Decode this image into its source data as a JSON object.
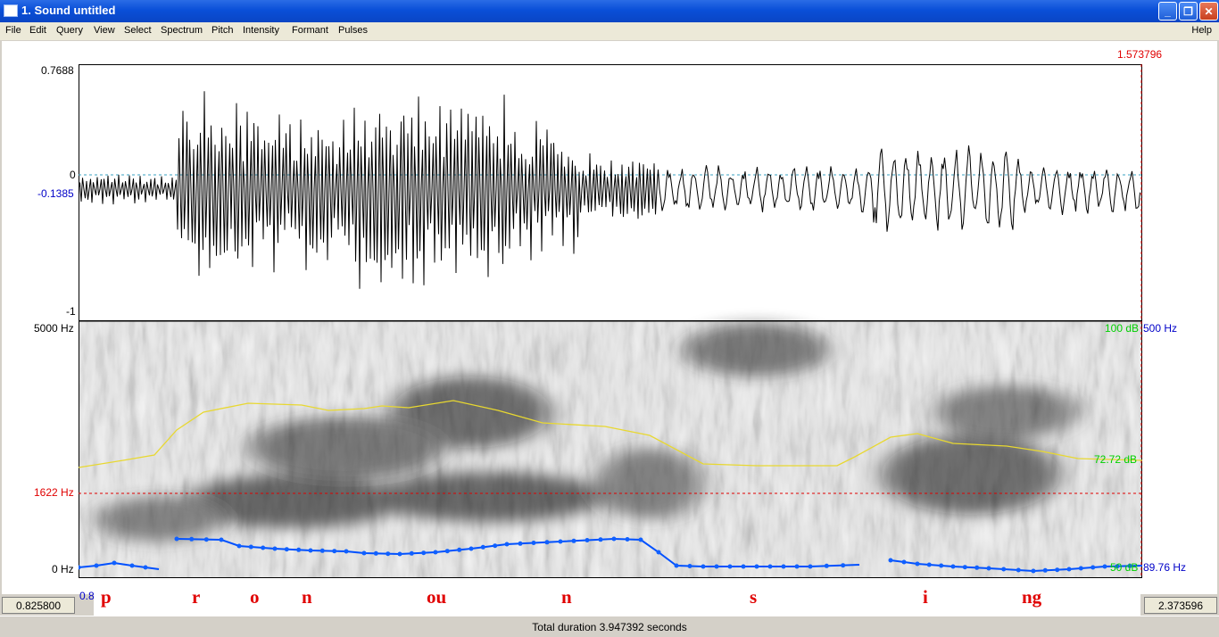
{
  "window": {
    "title": "1. Sound untitled"
  },
  "menu": {
    "items": [
      "File",
      "Edit",
      "Query",
      "View",
      "Select",
      "Spectrum",
      "Pitch",
      "Intensity",
      "Formant",
      "Pulses"
    ],
    "help": "Help"
  },
  "cursor_time": "1.573796",
  "waveform": {
    "max_label": "0.7688",
    "zero_label": "0",
    "cursor_value": "-0.1385",
    "min_label": "-1"
  },
  "spectrogram": {
    "top_freq": "5000 Hz",
    "cursor_freq": "1622 Hz",
    "bottom_freq": "0 Hz",
    "intensity_max": "100 dB",
    "intensity_value": "72.72 dB",
    "intensity_min": "50 dB",
    "pitch_max": "500 Hz",
    "pitch_value": "89.76 Hz"
  },
  "textgrid": {
    "segments": [
      "p",
      "r",
      "o",
      "n",
      "ou",
      "n",
      "s",
      "i",
      "ng"
    ]
  },
  "view": {
    "start_time": "0.825800",
    "end_time": "2.373596",
    "left_partial": "0.8"
  },
  "status": {
    "total_duration": "Total duration 3.947392 seconds"
  },
  "colors": {
    "cursor": "#e00000",
    "intensity": "#e8d830",
    "pitch": "#0050ff",
    "db_label": "#00d000",
    "pitch_label": "#0000c8"
  }
}
